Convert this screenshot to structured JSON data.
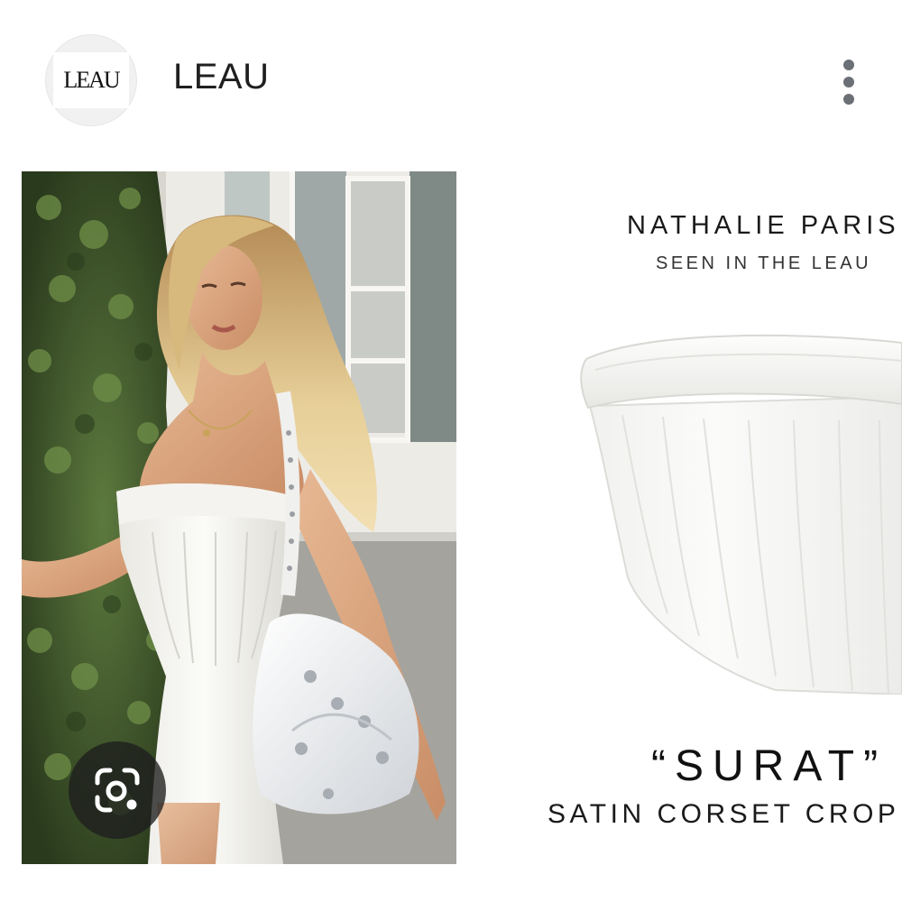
{
  "header": {
    "account_name": "LEAU",
    "avatar_logo_text": "LEAU"
  },
  "photo": {
    "lens_icon": "google-lens-icon"
  },
  "promo": {
    "brand_line": "NATHALIE PARIS",
    "seen_line": "SEEN IN THE LEAU",
    "product_name": "“SURAT”",
    "product_desc": "SATIN CORSET CROP"
  },
  "colors": {
    "text_dark": "#1f1f1f",
    "menu_dots": "#6b6f76",
    "lens_bg": "#1e1e1e"
  }
}
